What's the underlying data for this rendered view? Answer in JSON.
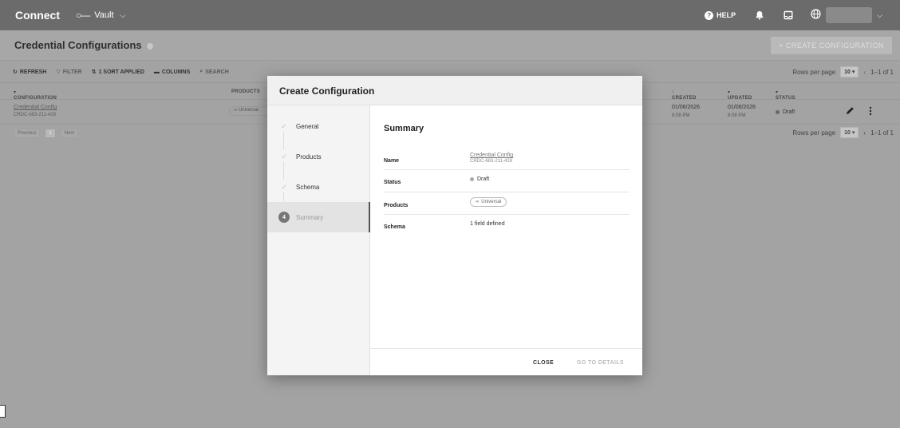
{
  "app": {
    "brand": "Connect",
    "workspace": "Vault",
    "help": "HELP"
  },
  "page": {
    "title": "Credential Configurations",
    "create_button": "+ CREATE CONFIGURATION"
  },
  "toolbar": {
    "refresh": "REFRESH",
    "filter": "FILTER",
    "sort": "1 SORT APPLIED",
    "columns": "COLUMNS",
    "search": "SEARCH",
    "rows_per_page_label": "Rows per page",
    "rows_per_page_value": "10",
    "range": "1–1 of 1"
  },
  "table": {
    "columns": {
      "configuration": "CONFIGURATION",
      "products": "PRODUCTS",
      "created": "CREATED",
      "updated": "UPDATED",
      "status": "STATUS"
    },
    "rows": [
      {
        "name": "Credential Config",
        "id": "CRDC-683-211-428",
        "product": "Universal",
        "created_date": "01/06/2026",
        "created_time": "8:08 PM",
        "updated_date": "01/06/2026",
        "updated_time": "8:08 PM",
        "status": "Draft"
      }
    ],
    "pager": {
      "previous": "Previous",
      "page": "1",
      "next": "Next"
    }
  },
  "modal": {
    "title": "Create Configuration",
    "steps": [
      {
        "label": "General",
        "state": "done"
      },
      {
        "label": "Products",
        "state": "done"
      },
      {
        "label": "Schema",
        "state": "done"
      },
      {
        "label": "Summary",
        "state": "active",
        "number": "4"
      }
    ],
    "summary": {
      "title": "Summary",
      "name_label": "Name",
      "name_value": "Credential Config",
      "name_id": "CRDC-683-211-428",
      "status_label": "Status",
      "status_value": "Draft",
      "products_label": "Products",
      "products_value": "Universal",
      "schema_label": "Schema",
      "schema_value": "1 field defined"
    },
    "footer": {
      "close": "CLOSE",
      "go_to_details": "GO TO DETAILS"
    }
  }
}
